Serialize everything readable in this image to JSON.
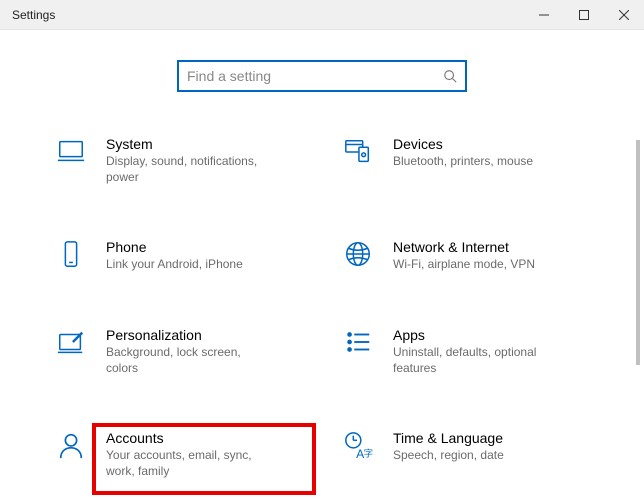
{
  "window": {
    "title": "Settings"
  },
  "search": {
    "placeholder": "Find a setting",
    "value": ""
  },
  "tiles": [
    {
      "key": "system",
      "title": "System",
      "subtitle": "Display, sound, notifications, power"
    },
    {
      "key": "devices",
      "title": "Devices",
      "subtitle": "Bluetooth, printers, mouse"
    },
    {
      "key": "phone",
      "title": "Phone",
      "subtitle": "Link your Android, iPhone"
    },
    {
      "key": "network",
      "title": "Network & Internet",
      "subtitle": "Wi-Fi, airplane mode, VPN"
    },
    {
      "key": "personalization",
      "title": "Personalization",
      "subtitle": "Background, lock screen, colors"
    },
    {
      "key": "apps",
      "title": "Apps",
      "subtitle": "Uninstall, defaults, optional features"
    },
    {
      "key": "accounts",
      "title": "Accounts",
      "subtitle": "Your accounts, email, sync, work, family"
    },
    {
      "key": "time",
      "title": "Time & Language",
      "subtitle": "Speech, region, date"
    }
  ],
  "highlighted_tile": "accounts"
}
